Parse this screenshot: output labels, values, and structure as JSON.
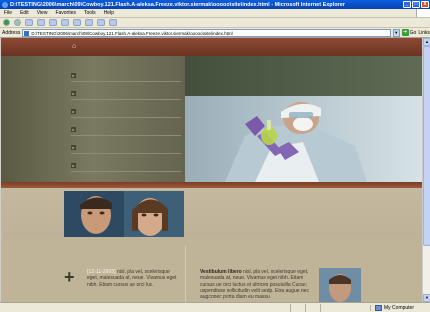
{
  "window": {
    "title": "D:\\TESTING\\2006\\march\\09\\Cowboy.121.Flash.A-aleksa.Freeze.viktor.siermak\\ooooo\\site\\index.html - Microsoft Internet Explorer",
    "controls": [
      "_",
      "□",
      "x"
    ]
  },
  "menu": [
    "File",
    "Edit",
    "View",
    "Favorites",
    "Tools",
    "Help"
  ],
  "address": {
    "label": "Address",
    "value": "D:\\TESTING\\2006\\march\\09\\Cowboy.121.Flash.A-aleksa.Freeze.viktor.siermak\\ooooo\\site\\index.html",
    "go": "Go",
    "links": "Links"
  },
  "site": {
    "home_icon": "home-icon",
    "nav_count_note": "6 nav items with arrow bullets",
    "left_col": {
      "date": "[12-11-2003]",
      "text": " nisl, pla vel, scelerisque eget, malesuada at, neue. Vivamus eget nibh. Etiam cursus ue orci luc."
    },
    "right_col": {
      "lead": "Vestibulum libero",
      "text": " nisl, pla vel, scelerisque eget, malesuada at, neue. Vivamus eget nibh. Etiam cursus ue orci luctus et ultrices posuluilla Curae; uspendisse sollicitudin velit sedp. Etra augue nec augconec porta diam eu massu"
    }
  },
  "status": {
    "zone": "My Computer"
  },
  "colors": {
    "site_brown": "#6a3322",
    "nav_olive": "#6e6e56",
    "beige": "#bfb398"
  }
}
